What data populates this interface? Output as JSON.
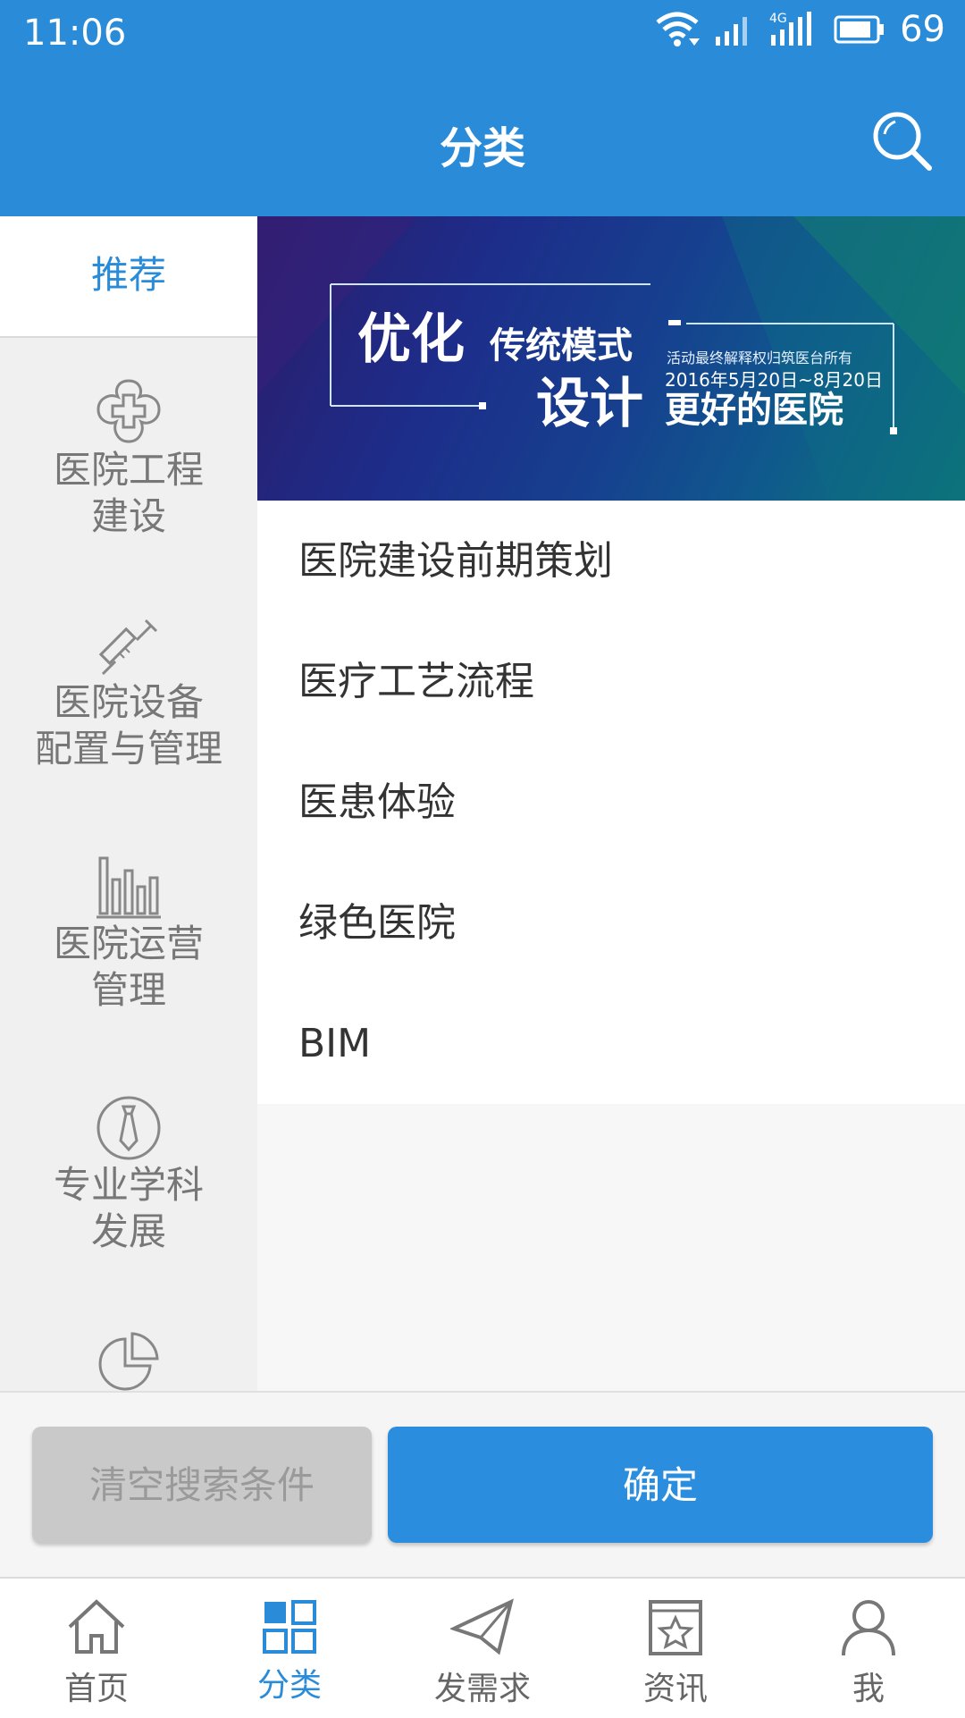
{
  "status_bar": {
    "time": "11:06",
    "network": "4G",
    "battery": "69"
  },
  "header": {
    "title": "分类"
  },
  "sidebar": {
    "items": [
      {
        "label": "推荐",
        "icon": "none",
        "active": true
      },
      {
        "label_line1": "医院工程",
        "label_line2": "建设",
        "icon": "medical-cross-icon"
      },
      {
        "label_line1": "医院设备",
        "label_line2": "配置与管理",
        "icon": "syringe-icon"
      },
      {
        "label_line1": "医院运营",
        "label_line2": "管理",
        "icon": "bar-chart-icon"
      },
      {
        "label_line1": "专业学科",
        "label_line2": "发展",
        "icon": "tie-icon"
      },
      {
        "icon": "pie-chart-icon"
      }
    ]
  },
  "banner": {
    "line1_big": "优化",
    "line1_small": "传统模式",
    "line2_big": "设计",
    "line2_small": "更好的医院",
    "note": "活动最终解释权归筑医台所有",
    "date": "2016年5月20日~8月20日"
  },
  "list": {
    "items": [
      "医院建设前期策划",
      "医疗工艺流程",
      "医患体验",
      "绿色医院",
      "BIM"
    ]
  },
  "actions": {
    "clear_label": "清空搜索条件",
    "confirm_label": "确定"
  },
  "tabs": [
    {
      "label": "首页",
      "icon": "home-icon"
    },
    {
      "label": "分类",
      "icon": "grid-icon",
      "active": true
    },
    {
      "label": "发需求",
      "icon": "paper-plane-icon"
    },
    {
      "label": "资讯",
      "icon": "news-icon"
    },
    {
      "label": "我",
      "icon": "user-icon"
    }
  ],
  "colors": {
    "primary": "#2a8bd9",
    "clear_button": "#c9c9c9",
    "sidebar_bg": "#f0f0f0"
  }
}
